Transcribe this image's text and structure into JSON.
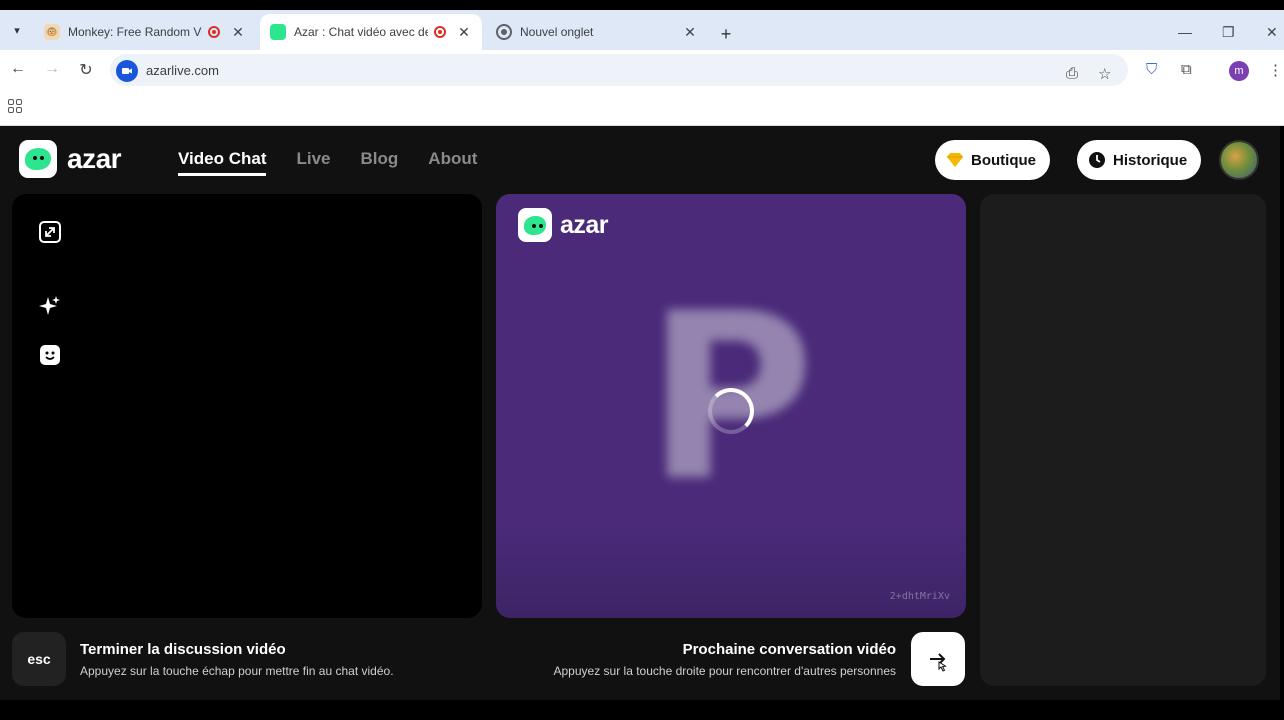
{
  "browser": {
    "tabs": [
      {
        "title": "Monkey: Free Random Vide",
        "recording": true,
        "active": false
      },
      {
        "title": "Azar : Chat vidéo avec de n",
        "recording": true,
        "active": true
      },
      {
        "title": "Nouvel onglet",
        "recording": false,
        "active": false
      }
    ],
    "url": "azarlive.com",
    "profile_initial": "m"
  },
  "header": {
    "logo_text": "azar",
    "nav": [
      {
        "label": "Video Chat",
        "active": true
      },
      {
        "label": "Live",
        "active": false
      },
      {
        "label": "Blog",
        "active": false
      },
      {
        "label": "About",
        "active": false
      }
    ],
    "shop_label": "Boutique",
    "history_label": "Historique"
  },
  "video": {
    "logo_text": "azar",
    "placeholder_letter": "P",
    "session_code": "2+dhtMriXv"
  },
  "controls": {
    "esc_key": "esc",
    "end_title": "Terminer la discussion vidéo",
    "end_hint": "Appuyez sur la touche échap pour mettre fin au chat vidéo.",
    "next_title": "Prochaine conversation vidéo",
    "next_hint": "Appuyez sur la touche droite pour rencontrer d'autres personnes"
  },
  "colors": {
    "accent_green": "#2ee58f",
    "video_purple": "#4a2a79",
    "page_bg": "#111111"
  }
}
